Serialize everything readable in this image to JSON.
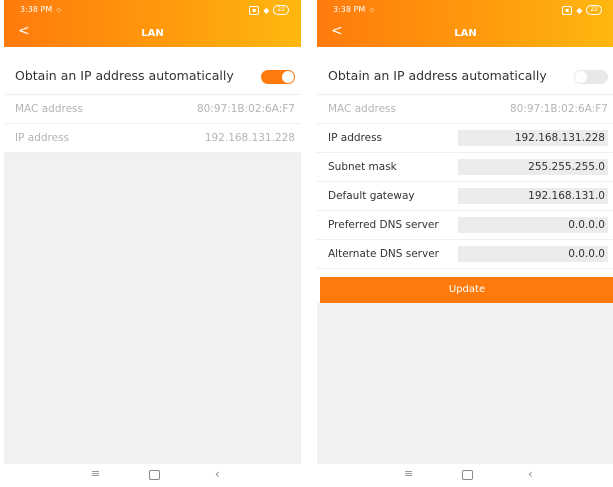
{
  "status_bar": {
    "time": "3:38 PM",
    "battery": "22"
  },
  "header": {
    "back": "<",
    "title": "LAN"
  },
  "left": {
    "toggle_label": "Obtain an IP address automatically",
    "toggle_on": true,
    "rows": [
      {
        "label": "MAC address",
        "value": "80:97:1B:02:6A:F7"
      },
      {
        "label": "IP address",
        "value": "192.168.131.228"
      }
    ]
  },
  "right": {
    "toggle_label": "Obtain an IP address automatically",
    "toggle_on": false,
    "mac": {
      "label": "MAC address",
      "value": "80:97:1B:02:6A:F7"
    },
    "fields": [
      {
        "label": "IP address",
        "value": "192.168.131.228"
      },
      {
        "label": "Subnet mask",
        "value": "255.255.255.0"
      },
      {
        "label": "Default gateway",
        "value": "192.168.131.0"
      },
      {
        "label": "Preferred DNS server",
        "value": "0.0.0.0"
      },
      {
        "label": "Alternate DNS server",
        "value": "0.0.0.0"
      }
    ],
    "update_label": "Update"
  },
  "nav_icons": [
    "menu-icon",
    "home-icon",
    "back-icon"
  ],
  "colors": {
    "accent": "#ff7a0d",
    "accent_end": "#ffb70e"
  }
}
